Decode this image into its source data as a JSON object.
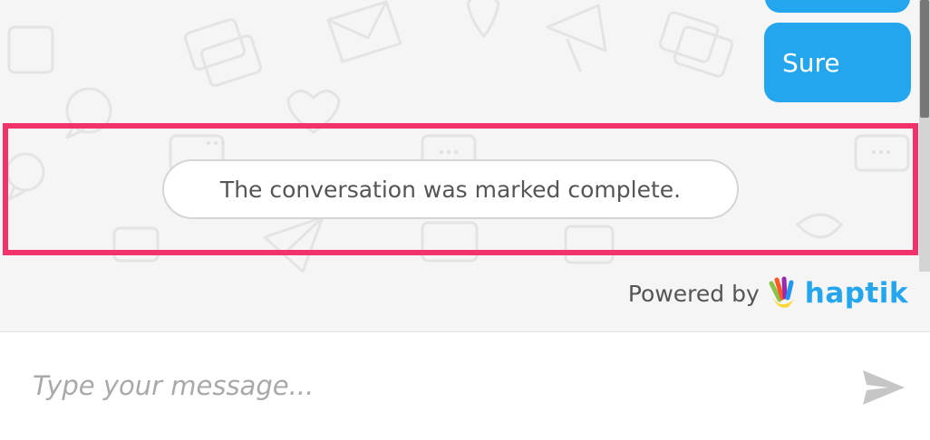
{
  "messages": [
    {
      "sender": "user",
      "text": ""
    },
    {
      "sender": "user",
      "text": "Sure"
    }
  ],
  "status_message": "The conversation was marked complete.",
  "footer": {
    "powered_by_label": "Powered by",
    "brand_name": "haptik",
    "brand_icon": "hand-logo-icon"
  },
  "composer": {
    "placeholder": "Type your message...",
    "value": "",
    "send_icon": "send-icon"
  },
  "colors": {
    "bubble": "#23a6ee",
    "brand": "#23a6ee",
    "highlight": "#f2336b",
    "background": "#f5f5f5"
  }
}
